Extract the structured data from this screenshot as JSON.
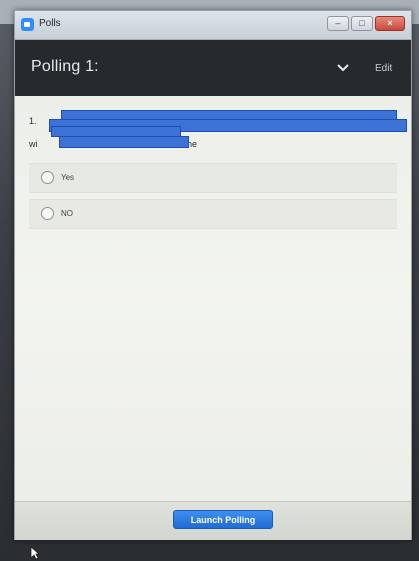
{
  "window": {
    "title": "Polls",
    "controls": {
      "minimize_glyph": "–",
      "maximize_glyph": "□",
      "close_glyph": "×"
    }
  },
  "header": {
    "title": "Polling 1:",
    "dropdown_icon": "chevron-down",
    "edit_label": "Edit"
  },
  "question": {
    "number_prefix": "1.",
    "line2_prefix": "wi",
    "line2_suffix": "he",
    "redacted": true
  },
  "options": [
    {
      "label": "Yes",
      "selected": false
    },
    {
      "label": "NO",
      "selected": false
    }
  ],
  "footer": {
    "launch_label": "Launch Polling"
  },
  "colors": {
    "accent": "#2d8cff",
    "header_bg": "#262a2d",
    "redaction": "#3d73d6",
    "button": "#1f6cd6"
  }
}
